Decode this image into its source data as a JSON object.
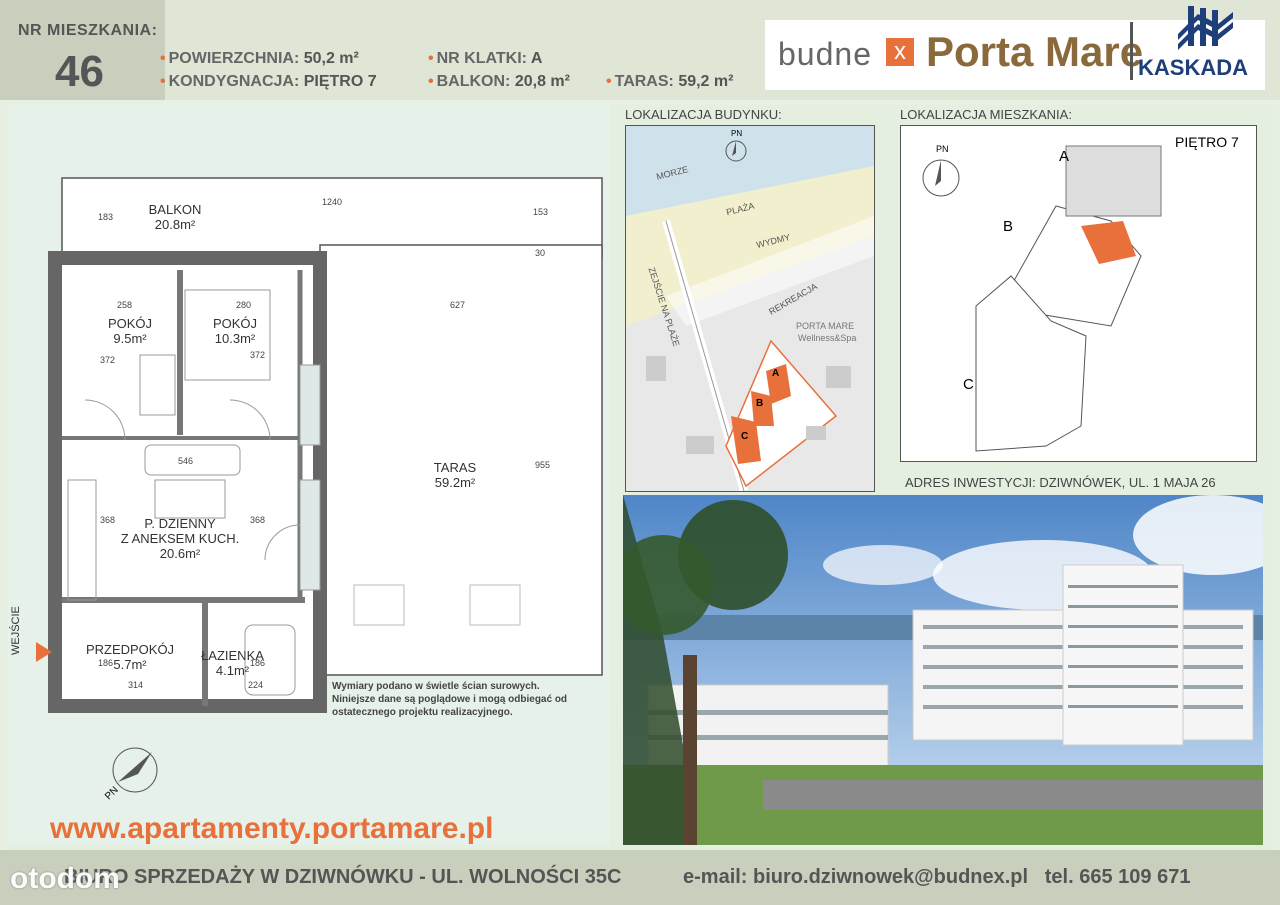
{
  "header": {
    "nr_label": "NR MIESZKANIA:",
    "nr_value": "46",
    "specs": [
      {
        "label": "POWIERZCHNIA:",
        "value": "50,2 m²"
      },
      {
        "label": "NR KLATKI:",
        "value": "A"
      },
      {
        "label": "KONDYGNACJA:",
        "value": "PIĘTRO 7"
      },
      {
        "label": "BALKON:",
        "value": "20,8 m²"
      },
      {
        "label": "TARAS:",
        "value": "59,2 m²"
      }
    ],
    "logo_budnex": "budne",
    "logo_budnex_x": "x",
    "logo_portamare": "Porta Mare",
    "logo_kaskada": "KASKADA"
  },
  "plan": {
    "rooms": [
      {
        "name": "BALKON",
        "area": "20.8m²"
      },
      {
        "name": "POKÓJ",
        "area": "9.5m²"
      },
      {
        "name": "POKÓJ",
        "area": "10.3m²"
      },
      {
        "name": "TARAS",
        "area": "59.2m²"
      },
      {
        "name": "P. DZIENNY",
        "name2": "Z ANEKSEM KUCH.",
        "area": "20.6m²"
      },
      {
        "name": "PRZEDPOKÓJ",
        "area": "5.7m²"
      },
      {
        "name": "ŁAZIENKA",
        "area": "4.1m²"
      }
    ],
    "dims": {
      "d1240": "1240",
      "d183": "183",
      "d153": "153",
      "d30": "30",
      "d258": "258",
      "d280": "280",
      "d627": "627",
      "d372a": "372",
      "d372b": "372",
      "d546": "546",
      "d368a": "368",
      "d368b": "368",
      "d955": "955",
      "d186a": "186",
      "d186b": "186",
      "d314": "314",
      "d224": "224"
    },
    "entrance": "WEJŚCIE",
    "north": "PN",
    "disclaimer": [
      "Wymiary podano w świetle ścian surowych.",
      "Niniejsze dane są poglądowe i mogą odbiegać od",
      "ostatecznego projektu realizacyjnego."
    ]
  },
  "map_building": {
    "title": "LOKALIZACJA BUDYNKU:",
    "labels": {
      "morze": "MORZE",
      "plaza": "PLAŻA",
      "wydmy": "WYDMY",
      "zejscie": "ZEJŚCIE NA PLAŻE",
      "rekreacja": "REKREACJA",
      "porta": "PORTA MARE",
      "wellness": "Wellness&Spa",
      "pn": "PN",
      "a": "A",
      "b": "B",
      "c": "C"
    }
  },
  "map_apartment": {
    "title": "LOKALIZACJA MIESZKANIA:",
    "floor": "PIĘTRO 7",
    "labels": {
      "pn": "PN",
      "a": "A",
      "b": "B",
      "c": "C"
    }
  },
  "address": "ADRES INWESTYCJI: DZIWNÓWEK, UL. 1 MAJA 26",
  "url": "www.apartamenty.portamare.pl",
  "footer": {
    "office": "BIURO SPRZEDAŻY W DZIWNÓWKU - UL. WOLNOŚCI 35C",
    "email_label": "e-mail: biuro.dziwnowek@budnex.pl",
    "tel_label": "tel.",
    "tel": "665 109 671",
    "watermark": "otodom"
  },
  "colors": {
    "accent": "#e8703a",
    "brand_blue": "#1e3f7a",
    "brand_gold": "#8a6a3a"
  }
}
